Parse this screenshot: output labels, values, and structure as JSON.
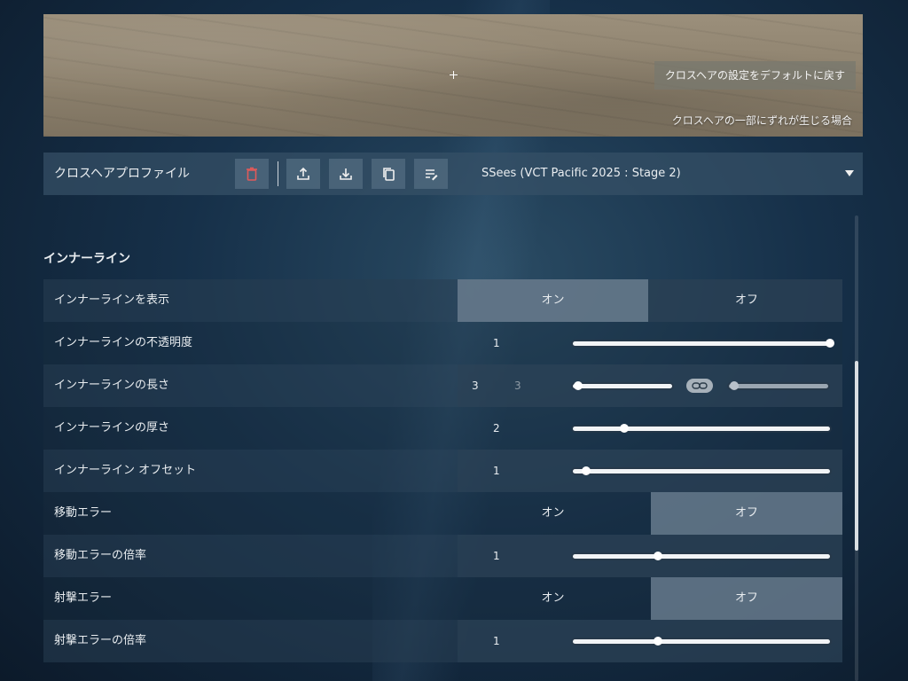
{
  "preview": {
    "reset_label": "クロスヘアの設定をデフォルトに戻す",
    "note": "クロスヘアの一部にずれが生じる場合"
  },
  "profile": {
    "label": "クロスヘアプロファイル",
    "selected": "SSees (VCT Pacific 2025 : Stage 2)",
    "tools": [
      "delete-icon",
      "upload-icon",
      "download-icon",
      "copy-icon",
      "rename-icon"
    ]
  },
  "section": {
    "title": "インナーライン"
  },
  "rows": {
    "show": {
      "label": "インナーラインを表示",
      "on": "オン",
      "off": "オフ",
      "selected": "on"
    },
    "opacity": {
      "label": "インナーラインの不透明度",
      "value": "1",
      "level": 1.0
    },
    "length": {
      "label": "インナーラインの長さ",
      "value_h": "3",
      "value_v": "3",
      "level_h": 0.05,
      "level_v": 0.05,
      "linked": true
    },
    "thickness": {
      "label": "インナーラインの厚さ",
      "value": "2",
      "level": 0.2
    },
    "offset": {
      "label": "インナーライン オフセット",
      "value": "1",
      "level": 0.05
    },
    "move_error": {
      "label": "移動エラー",
      "on": "オン",
      "off": "オフ",
      "selected": "off"
    },
    "move_mult": {
      "label": "移動エラーの倍率",
      "value": "1",
      "level": 0.33
    },
    "fire_error": {
      "label": "射撃エラー",
      "on": "オン",
      "off": "オフ",
      "selected": "off"
    },
    "fire_mult": {
      "label": "射撃エラーの倍率",
      "value": "1",
      "level": 0.33
    }
  },
  "colors": {
    "delete_accent": "#e05a5a",
    "selected_toggle": "#6e8294"
  }
}
